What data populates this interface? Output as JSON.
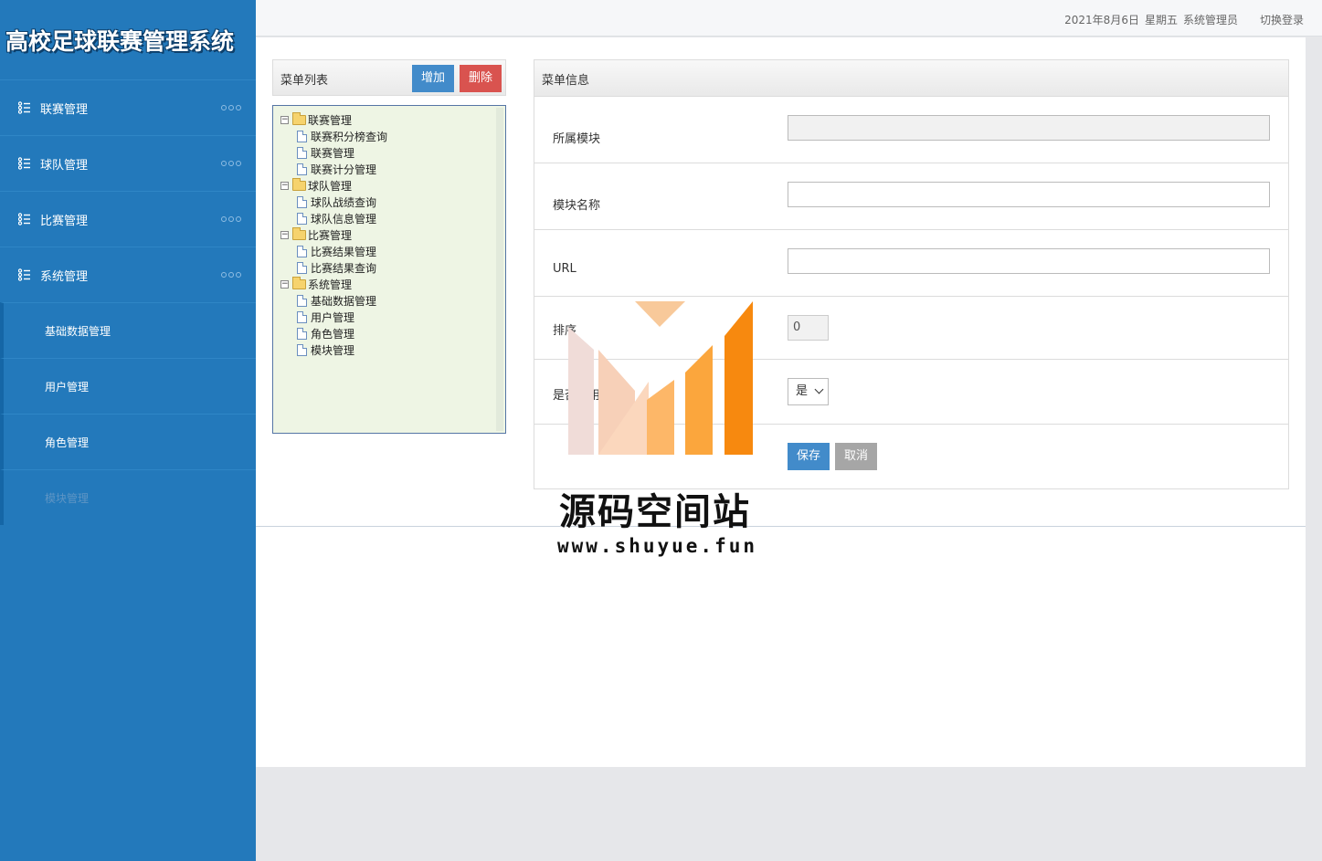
{
  "app": {
    "title": "高校足球联赛管理系统"
  },
  "topbar": {
    "date": "2021年8月6日",
    "weekday": "星期五",
    "user": "系统管理员",
    "switch_login": "切换登录"
  },
  "sidebar": {
    "items": [
      {
        "label": "联赛管理",
        "icon": "list-icon"
      },
      {
        "label": "球队管理",
        "icon": "list-icon"
      },
      {
        "label": "比赛管理",
        "icon": "list-icon"
      },
      {
        "label": "系统管理",
        "icon": "list-icon"
      }
    ],
    "subitems": [
      {
        "label": "基础数据管理"
      },
      {
        "label": "用户管理"
      },
      {
        "label": "角色管理"
      },
      {
        "label": "模块管理",
        "active": true
      }
    ]
  },
  "menu_list": {
    "title": "菜单列表",
    "add_label": "增加",
    "delete_label": "删除",
    "tree": [
      {
        "label": "联赛管理",
        "children": [
          "联赛积分榜查询",
          "联赛管理",
          "联赛计分管理"
        ]
      },
      {
        "label": "球队管理",
        "children": [
          "球队战绩查询",
          "球队信息管理"
        ]
      },
      {
        "label": "比赛管理",
        "children": [
          "比赛结果管理",
          "比赛结果查询"
        ]
      },
      {
        "label": "系统管理",
        "children": [
          "基础数据管理",
          "用户管理",
          "角色管理",
          "模块管理"
        ]
      }
    ]
  },
  "menu_info": {
    "title": "菜单信息",
    "module_label": "所属模块",
    "module_value": "",
    "name_label": "模块名称",
    "name_value": "",
    "url_label": "URL",
    "url_value": "",
    "sort_label": "排序",
    "sort_value": "0",
    "enabled_label": "是否启用",
    "enabled_value": "是",
    "save_label": "保存",
    "cancel_label": "取消"
  },
  "watermark": {
    "name": "源码空间站",
    "url": "www.shuyue.fun"
  },
  "colors": {
    "sidebar": "#2379bb",
    "primary": "#428bca",
    "danger": "#d9534f"
  }
}
